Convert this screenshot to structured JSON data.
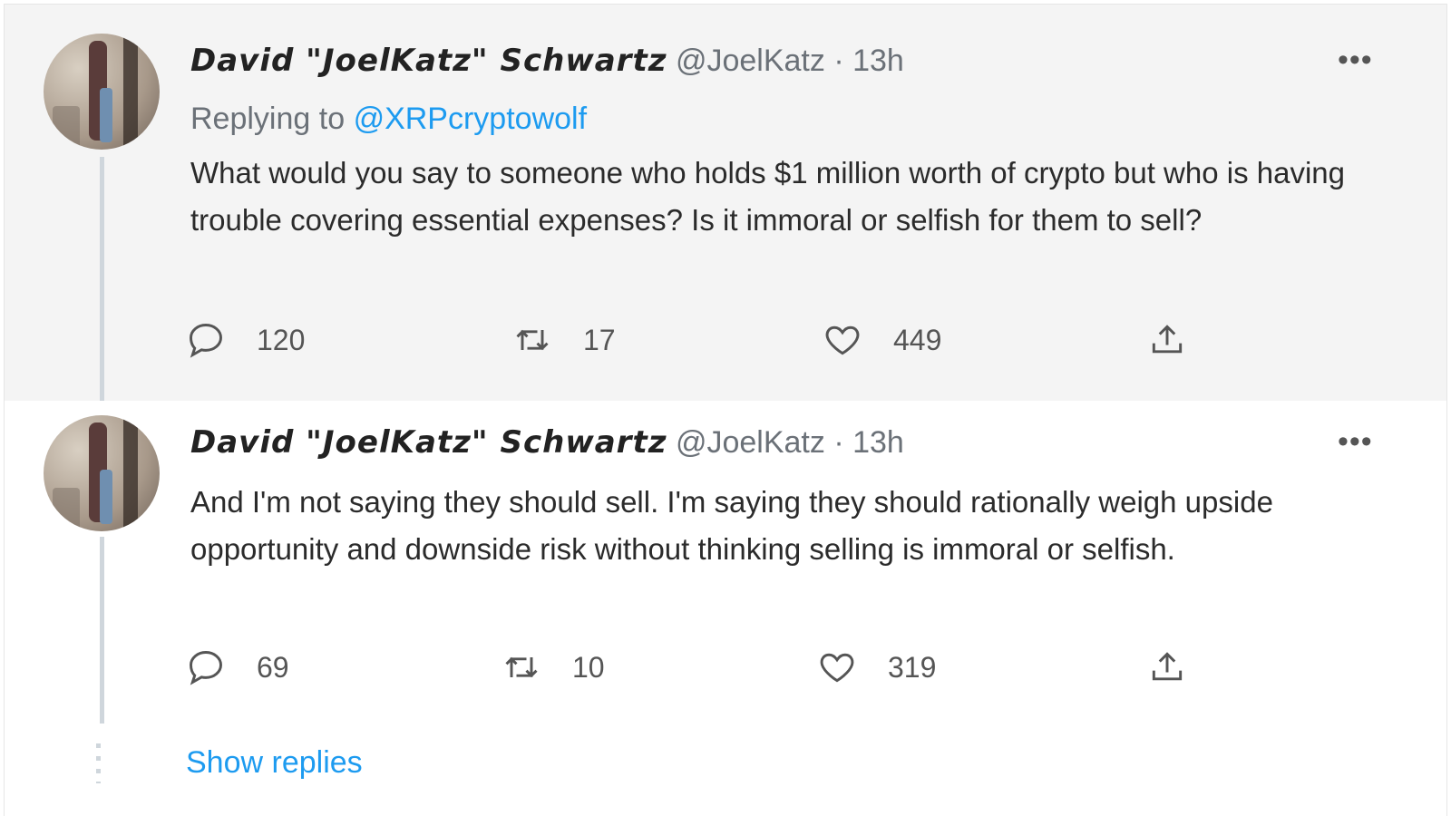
{
  "tweets": [
    {
      "name": "David \"JoelKatz\" Schwartz",
      "handle": "@JoelKatz",
      "time": "13h",
      "replying_label": "Replying to",
      "replying_to": "@XRPcryptowolf",
      "text": "What would you say to someone who holds $1 million worth of crypto but who is having trouble covering essential expenses? Is it immoral or selfish for them to sell?",
      "replies": "120",
      "retweets": "17",
      "likes": "449"
    },
    {
      "name": "David \"JoelKatz\" Schwartz",
      "handle": "@JoelKatz",
      "time": "13h",
      "text": "And I'm not saying they should sell. I'm saying they should rationally weigh upside opportunity and downside risk without thinking selling is immoral or selfish.",
      "replies": "69",
      "retweets": "10",
      "likes": "319"
    }
  ],
  "more_label": "•••",
  "separator": "·",
  "show_replies": "Show replies",
  "icons": [
    "reply-icon",
    "retweet-icon",
    "like-icon",
    "share-icon",
    "more-icon"
  ],
  "colors": {
    "link": "#1d9bf0",
    "first_bg": "#f4f4f4"
  }
}
